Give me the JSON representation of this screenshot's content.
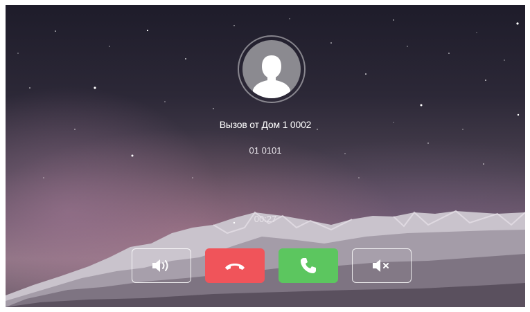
{
  "call": {
    "caller_label": "Вызов от Дом 1 0002",
    "number": "01 0101",
    "duration": "00:27"
  },
  "controls": {
    "speaker_icon": "speaker-icon",
    "hangup_icon": "phone-hangup-icon",
    "answer_icon": "phone-answer-icon",
    "mute_icon": "speaker-mute-icon"
  },
  "colors": {
    "hangup": "#f0545a",
    "answer": "#5cc65f",
    "avatar": "#8b8a90"
  }
}
